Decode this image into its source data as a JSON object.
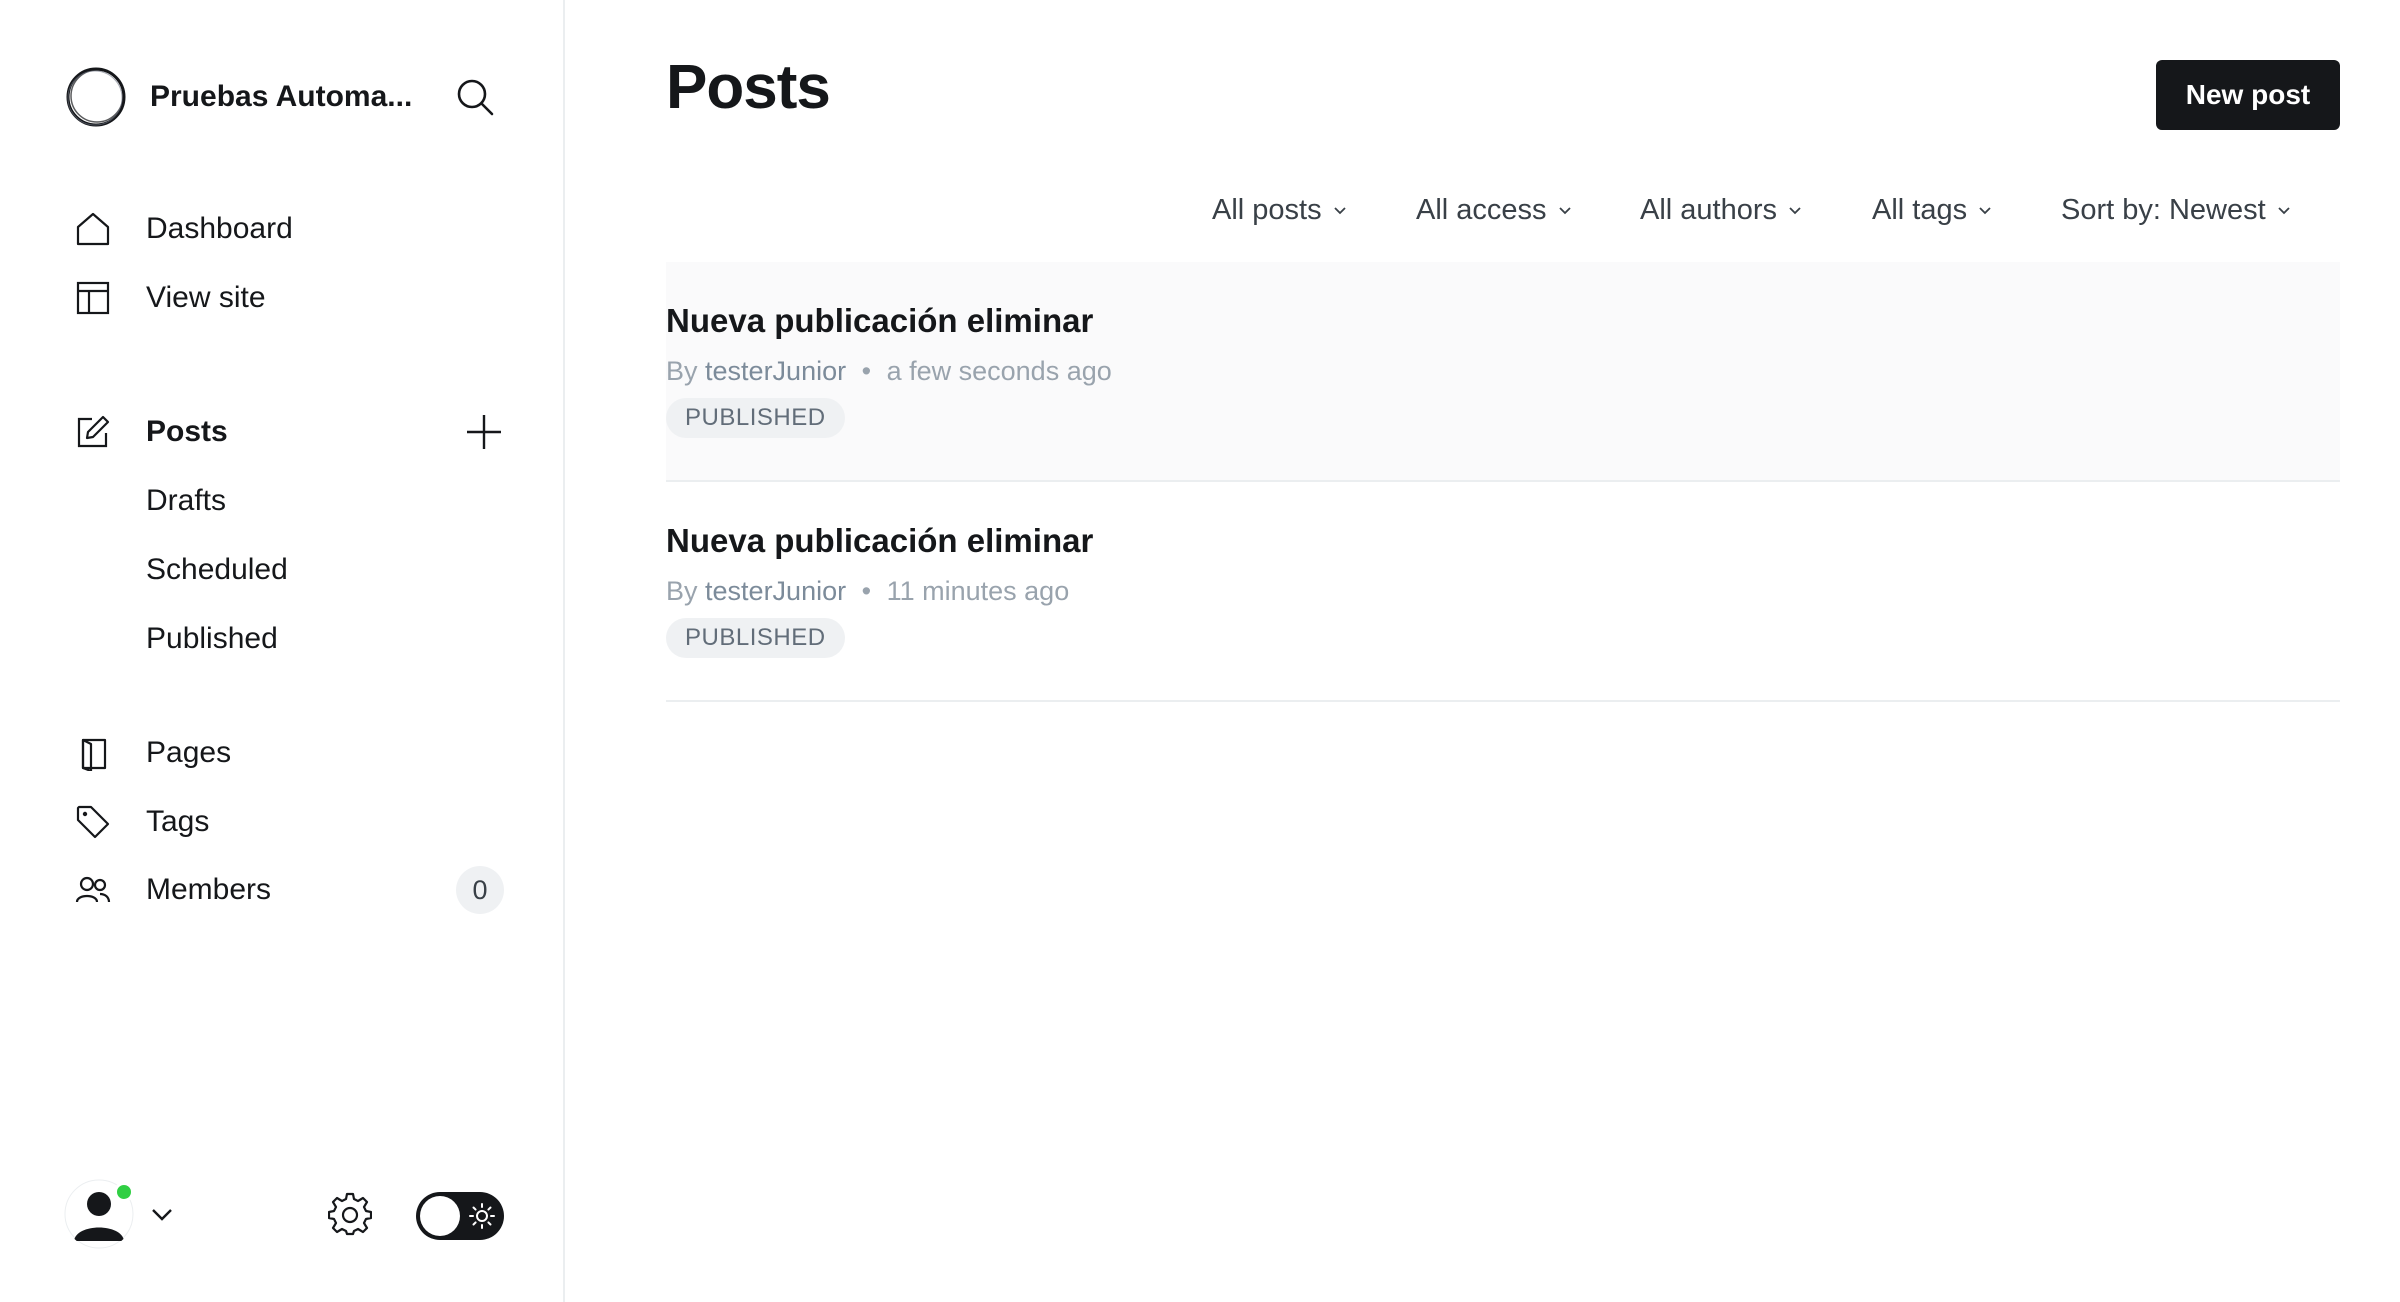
{
  "site": {
    "title": "Pruebas Automa..."
  },
  "nav": {
    "dashboard": "Dashboard",
    "view_site": "View site",
    "posts": "Posts",
    "drafts": "Drafts",
    "scheduled": "Scheduled",
    "published": "Published",
    "pages": "Pages",
    "tags": "Tags",
    "members": "Members",
    "members_count": "0"
  },
  "main": {
    "title": "Posts",
    "new_post_label": "New post",
    "filters": {
      "type": "All posts",
      "access": "All access",
      "authors": "All authors",
      "tags": "All tags",
      "sort": "Sort by: Newest"
    },
    "posts": [
      {
        "title": "Nueva publicación eliminar",
        "by": "By",
        "author": "testerJunior",
        "dot": "•",
        "time": "a few seconds ago",
        "status": "PUBLISHED"
      },
      {
        "title": "Nueva publicación eliminar",
        "by": "By",
        "author": "testerJunior",
        "dot": "•",
        "time": "11 minutes ago",
        "status": "PUBLISHED"
      }
    ]
  },
  "colors": {
    "accent_dark": "#15171a",
    "status_online": "#30cf43",
    "badge_bg": "#eff1f3",
    "muted_text": "#99a3ad"
  },
  "icons": {
    "logo": "site-logo-ring",
    "search": "search-icon",
    "dashboard": "home-icon",
    "view_site": "layout-icon",
    "posts": "edit-icon",
    "add": "plus-icon",
    "pages": "page-icon",
    "tags": "tag-icon",
    "members": "members-icon",
    "settings": "gear-icon",
    "theme": "sun-icon"
  }
}
